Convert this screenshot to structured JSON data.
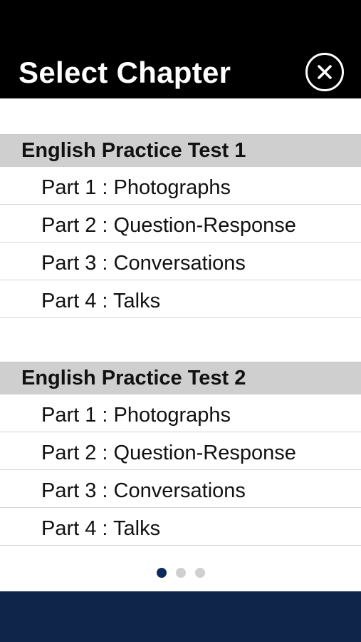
{
  "header": {
    "title": "Select Chapter"
  },
  "sections": [
    {
      "title": "English Practice Test 1",
      "items": [
        {
          "label": "Part 1 : Photographs"
        },
        {
          "label": "Part 2 : Question-Response"
        },
        {
          "label": "Part 3 : Conversations"
        },
        {
          "label": "Part 4 : Talks"
        }
      ]
    },
    {
      "title": "English Practice Test 2",
      "items": [
        {
          "label": "Part 1 : Photographs"
        },
        {
          "label": "Part 2 : Question-Response"
        },
        {
          "label": "Part 3 : Conversations"
        },
        {
          "label": "Part 4 : Talks"
        }
      ]
    }
  ],
  "pagination": {
    "total_pages": 3,
    "current_page": 1
  },
  "colors": {
    "header_bg": "#000000",
    "section_header_bg": "#cfcfcf",
    "active_dot": "#0d2a5c",
    "inactive_dot": "#d0d0d0",
    "footer_bg": "#0f2549"
  },
  "icons": {
    "close": "close-circle-icon"
  }
}
